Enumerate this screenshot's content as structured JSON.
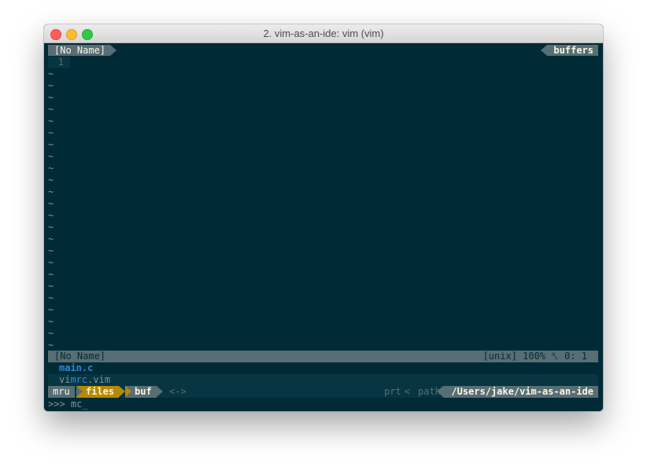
{
  "window": {
    "title": "2. vim-as-an-ide: vim (vim)"
  },
  "tabline": {
    "left_label": "[No Name]",
    "right_label": "buffers"
  },
  "buffer": {
    "line_number": "1",
    "tilde": "~",
    "tilde_count": 24
  },
  "statusline": {
    "filename": "[No Name]",
    "right": "[unix]    100% ␤   0:  1"
  },
  "ctrlp": {
    "results": [
      {
        "label": "main.c"
      },
      {
        "prefix": "vi",
        "match": "mrc",
        "suffix": ".vim"
      }
    ],
    "modes": {
      "mru": "mru",
      "files": "files",
      "buf": "buf"
    },
    "arrows": "<->",
    "prt": "prt",
    "sep": "<",
    "path_label": "path",
    "path": "/Users/jake/vim-as-an-ide",
    "prompt": ">>> mc",
    "cursor": "_"
  },
  "colors": {
    "background": "#002b36",
    "accent_yellow": "#b58900",
    "accent_blue": "#268bd2",
    "bar": "#586e75"
  }
}
